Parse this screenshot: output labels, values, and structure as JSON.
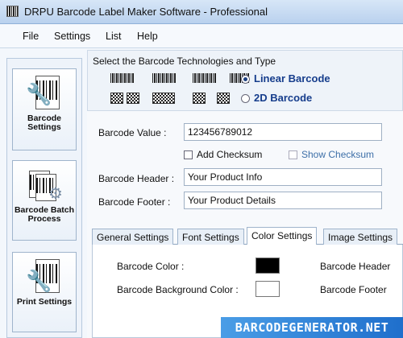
{
  "window": {
    "title": "DRPU Barcode Label Maker Software - Professional"
  },
  "menu": {
    "file": "File",
    "settings": "Settings",
    "list": "List",
    "help": "Help"
  },
  "sidebar": {
    "items": [
      {
        "label": "Barcode Settings",
        "icon": "barcode-settings-icon"
      },
      {
        "label": "Barcode Batch Process",
        "icon": "batch-process-icon"
      },
      {
        "label": "Print Settings",
        "icon": "print-settings-icon"
      }
    ]
  },
  "tech": {
    "title": "Select the Barcode Technologies and Type",
    "linear_label": "Linear Barcode",
    "twod_label": "2D Barcode",
    "selected": "Linear Barcode"
  },
  "form": {
    "value_label": "Barcode Value :",
    "value": "123456789012",
    "add_checksum": "Add Checksum",
    "show_checksum": "Show Checksum",
    "header_label": "Barcode Header :",
    "header_value": "Your Product Info",
    "footer_label": "Barcode Footer :",
    "footer_value": "Your Product Details"
  },
  "tabs": [
    "General Settings",
    "Font Settings",
    "Color Settings",
    "Image Settings"
  ],
  "active_tab": "Color Settings",
  "color_settings": {
    "barcode_color_label": "Barcode Color :",
    "barcode_color": "#000000",
    "background_label": "Barcode Background Color :",
    "background_color": "#ffffff",
    "header_label": "Barcode Header",
    "footer_label": "Barcode Footer"
  },
  "watermark": "BARCODEGENERATOR.NET"
}
